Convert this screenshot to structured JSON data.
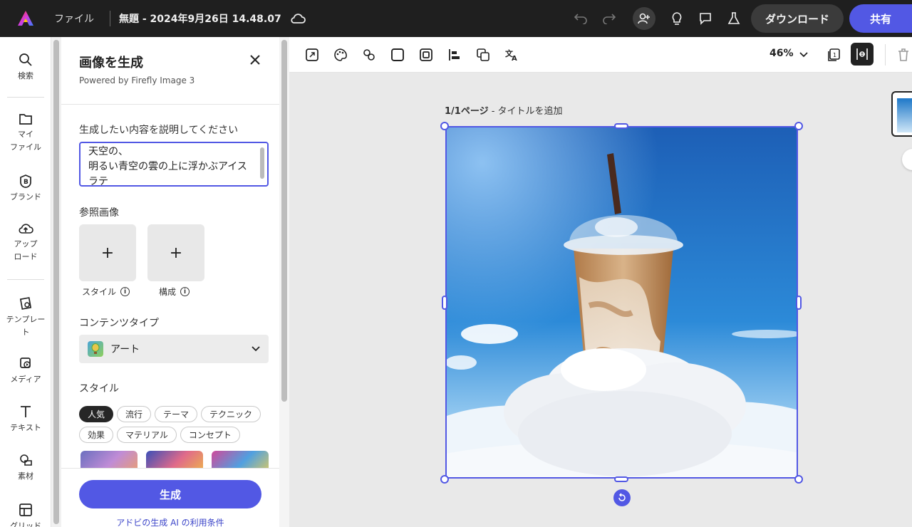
{
  "topbar": {
    "file_menu": "ファイル",
    "doc_title": "無題 - 2024年9月26日 14.48.07",
    "download_label": "ダウンロード",
    "share_label": "共有"
  },
  "rail": {
    "items": [
      {
        "label": "検索",
        "icon": "search-icon"
      },
      {
        "label": "マイ\nファイル",
        "icon": "folder-icon"
      },
      {
        "label": "ブランド",
        "icon": "brand-icon"
      },
      {
        "label": "アップ\nロード",
        "icon": "upload-icon"
      },
      {
        "label": "テンプレー\nト",
        "icon": "template-icon"
      },
      {
        "label": "メディア",
        "icon": "media-icon"
      },
      {
        "label": "テキスト",
        "icon": "text-icon"
      },
      {
        "label": "素材",
        "icon": "elements-icon"
      },
      {
        "label": "グリッド",
        "icon": "grid-icon"
      }
    ]
  },
  "panel": {
    "title": "画像を生成",
    "subtitle": "Powered by Firefly Image 3",
    "prompt_label": "生成したい内容を説明してください",
    "prompt_lines": [
      "天空の、",
      "明るい青空の雲の上に浮かぶアイス",
      "ラテ"
    ],
    "reference_label": "参照画像",
    "ref_style": "スタイル",
    "ref_composition": "構成",
    "content_type_label": "コンテンツタイプ",
    "content_type_value": "アート",
    "style_label": "スタイル",
    "chips": [
      "人気",
      "流行",
      "テーマ",
      "テクニック",
      "効果",
      "マテリアル",
      "コンセプト"
    ],
    "generate_label": "生成",
    "terms_label": "アドビの生成 AI の利用条件"
  },
  "toolbar": {
    "zoom": "46%"
  },
  "canvas": {
    "page_num": "1/1ページ",
    "page_title_placeholder": " - タイトルを追加"
  },
  "colors": {
    "accent": "#5258e4",
    "topbar": "#1f1f1f"
  }
}
